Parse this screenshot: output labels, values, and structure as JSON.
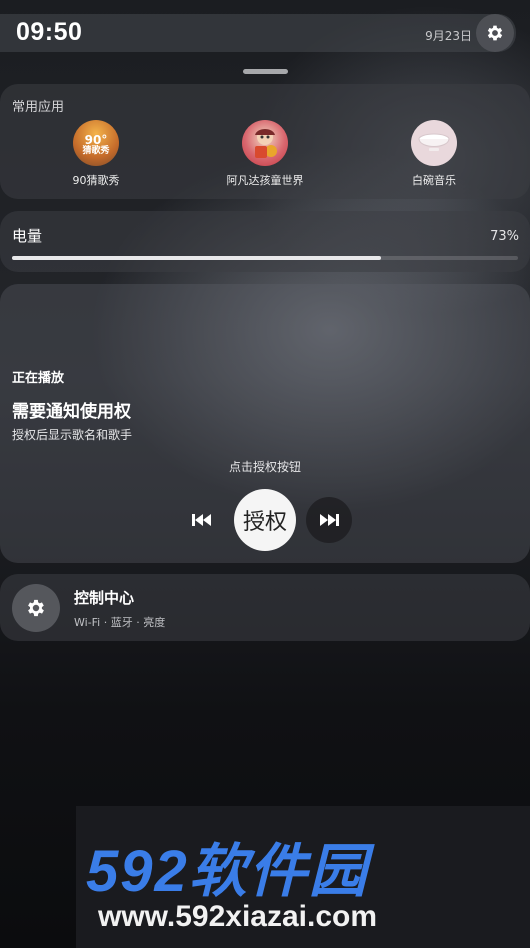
{
  "status": {
    "time": "09:50",
    "date": "9月23日"
  },
  "apps": {
    "title": "常用应用",
    "items": [
      {
        "label": "90猜歌秀",
        "icon_text": "90°",
        "icon_sub": "猜歌秀",
        "icon": "90-guess-song-app-icon"
      },
      {
        "label": "阿凡达孩童世界",
        "icon": "avatar-kids-world-app-icon"
      },
      {
        "label": "白碗音乐",
        "icon": "white-bowl-music-app-icon"
      }
    ]
  },
  "battery": {
    "label": "电量",
    "percent_text": "73%",
    "level": 0.73
  },
  "now_playing": {
    "header": "正在播放",
    "title": "需要通知使用权",
    "subtitle": "授权后显示歌名和歌手",
    "hint": "点击授权按钮",
    "authorize_label": "授权"
  },
  "control_center": {
    "title": "控制中心",
    "subtitle": "Wi-Fi · 蓝牙 · 亮度"
  },
  "watermark": {
    "brand": "592软件园",
    "url": "www.592xiazai.com"
  },
  "colors": {
    "accent_blue": "#3a7de8",
    "card": "#3c3e44"
  }
}
